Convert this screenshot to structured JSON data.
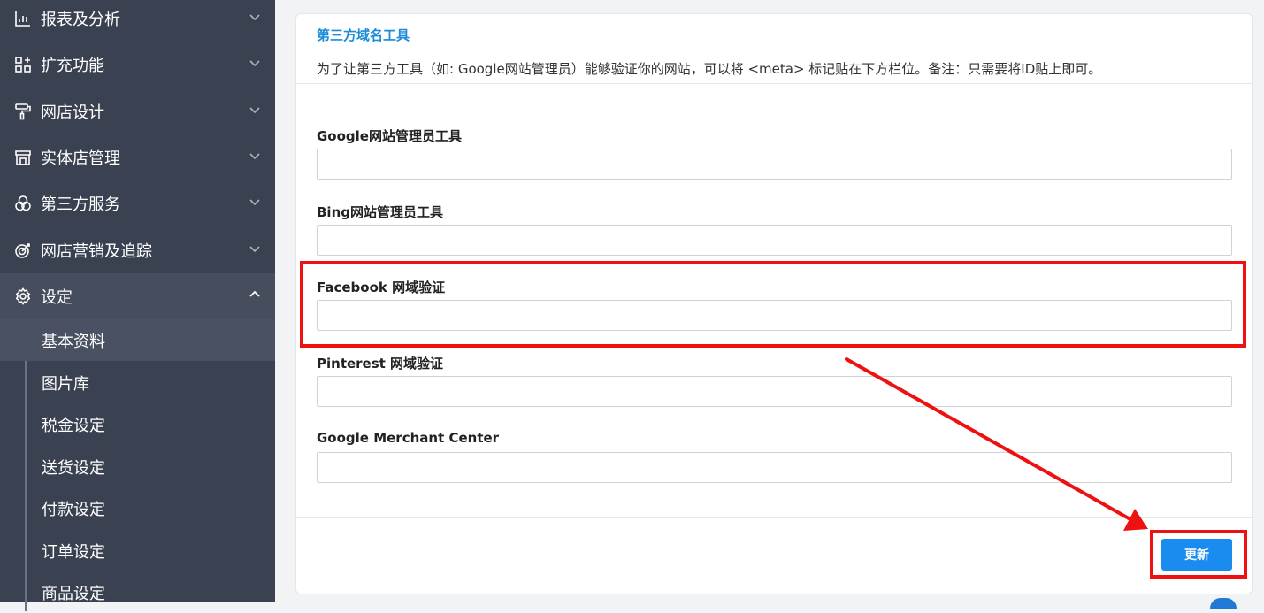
{
  "sidebar": {
    "items": [
      {
        "label": "报表及分析",
        "icon": "chart-icon"
      },
      {
        "label": "扩充功能",
        "icon": "apps-grid-icon"
      },
      {
        "label": "网店设计",
        "icon": "paint-roller-icon"
      },
      {
        "label": "实体店管理",
        "icon": "store-icon"
      },
      {
        "label": "第三方服务",
        "icon": "circles-icon"
      },
      {
        "label": "网店营销及追踪",
        "icon": "target-icon"
      },
      {
        "label": "设定",
        "icon": "gear-icon"
      }
    ],
    "sub_items": [
      {
        "label": "基本资料"
      },
      {
        "label": "图片库"
      },
      {
        "label": "税金设定"
      },
      {
        "label": "送货设定"
      },
      {
        "label": "付款设定"
      },
      {
        "label": "订单设定"
      },
      {
        "label": "商品设定"
      }
    ]
  },
  "main": {
    "title": "第三方域名工具",
    "description": "为了让第三方工具（如: Google网站管理员）能够验证你的网站，可以将 <meta> 标记贴在下方栏位。备注：只需要将ID贴上即可。",
    "fields": [
      {
        "label": "Google网站管理员工具",
        "value": ""
      },
      {
        "label": "Bing网站管理员工具",
        "value": ""
      },
      {
        "label": "Facebook 网域验证",
        "value": ""
      },
      {
        "label": "Pinterest 网域验证",
        "value": ""
      },
      {
        "label": "Google Merchant Center",
        "value": ""
      }
    ],
    "update_label": "更新"
  },
  "colors": {
    "sidebar_bg": "#3a4150",
    "accent": "#1a8cf0",
    "annotation": "#ee1111"
  }
}
